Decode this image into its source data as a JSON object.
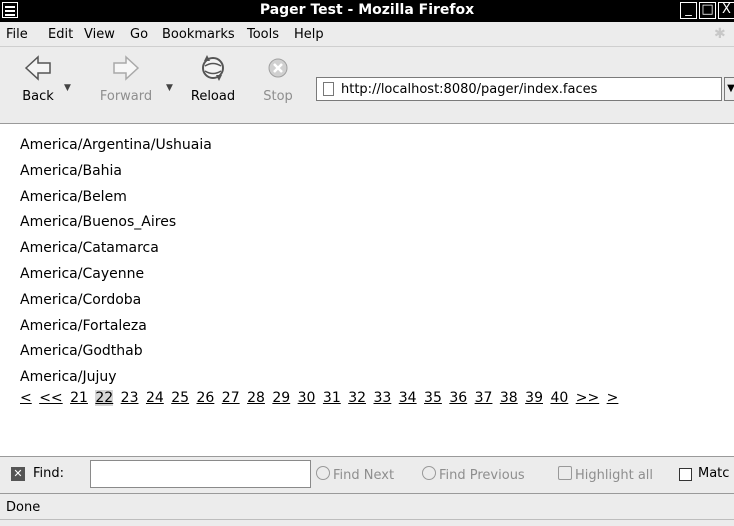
{
  "window": {
    "title": "Pager Test - Mozilla Firefox"
  },
  "menu": [
    {
      "label": "File"
    },
    {
      "label": "Edit"
    },
    {
      "label": "View"
    },
    {
      "label": "Go"
    },
    {
      "label": "Bookmarks"
    },
    {
      "label": "Tools"
    },
    {
      "label": "Help"
    }
  ],
  "toolbar": {
    "back": "Back",
    "forward": "Forward",
    "reload": "Reload",
    "stop": "Stop"
  },
  "url": "http://localhost:8080/pager/index.faces",
  "timezones": [
    "America/Argentina/Ushuaia",
    "America/Bahia",
    "America/Belem",
    "America/Buenos_Aires",
    "America/Catamarca",
    "America/Cayenne",
    "America/Cordoba",
    "America/Fortaleza",
    "America/Godthab",
    "America/Jujuy"
  ],
  "pager": {
    "first": "<",
    "prev_block": "<<",
    "pages": [
      "21",
      "22",
      "23",
      "24",
      "25",
      "26",
      "27",
      "28",
      "29",
      "30",
      "31",
      "32",
      "33",
      "34",
      "35",
      "36",
      "37",
      "38",
      "39",
      "40"
    ],
    "current": "22",
    "next_block": ">>",
    "last": ">"
  },
  "findbar": {
    "label": "Find:",
    "value": "",
    "find_next": "Find Next",
    "find_previous": "Find Previous",
    "highlight_all": "Highlight all",
    "match_case": "Matc"
  },
  "status": "Done"
}
